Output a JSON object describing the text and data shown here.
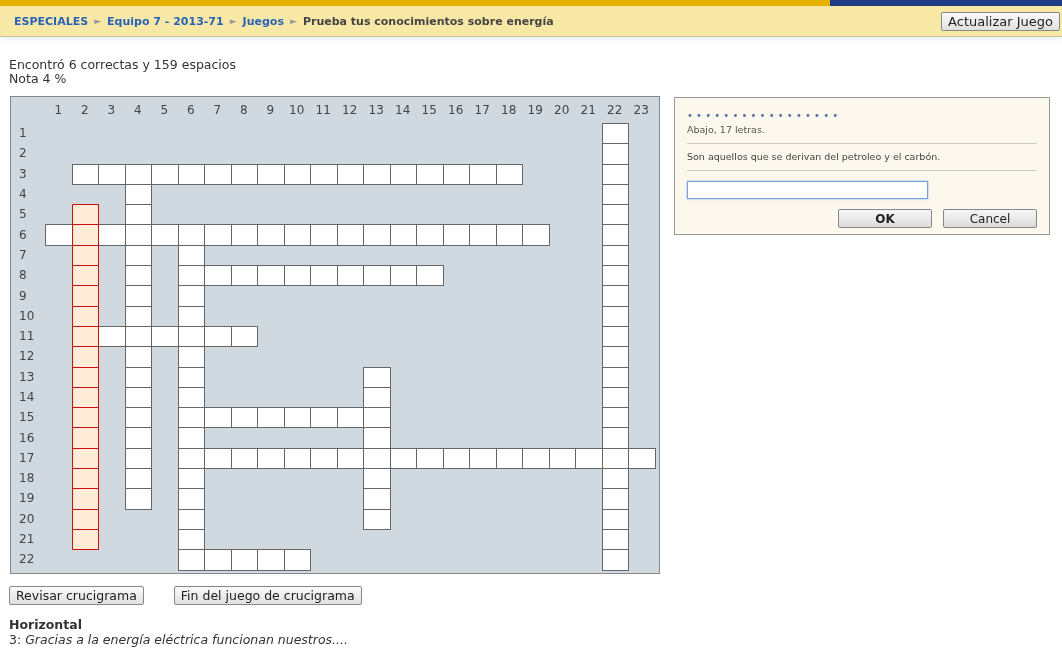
{
  "breadcrumb": [
    {
      "label": "ESPECIALES",
      "link": true
    },
    {
      "label": "Equipo 7 - 2013-71",
      "link": true
    },
    {
      "label": "Juegos",
      "link": true
    },
    {
      "label": "Prueba tus conocimientos sobre energía",
      "link": false
    }
  ],
  "breadcrumb_separator": "►",
  "update_button": "Actualizar Juego",
  "status": [
    "Encontró 6 correctas y 159 espacios",
    "Nota 4 %"
  ],
  "grid": {
    "column_numbers": [
      "1",
      "2",
      "3",
      "4",
      "5",
      "6",
      "7",
      "8",
      "9",
      "10",
      "11",
      "12",
      "13",
      "14",
      "15",
      "16",
      "17",
      "18",
      "19",
      "20",
      "21",
      "22",
      "23"
    ],
    "row_numbers": [
      "1",
      "2",
      "3",
      "4",
      "5",
      "6",
      "7",
      "8",
      "9",
      "10",
      "11",
      "12",
      "13",
      "14",
      "15",
      "16",
      "17",
      "18",
      "19",
      "20",
      "21",
      "22"
    ],
    "words": [
      {
        "selected": false
      },
      {
        "selected": false
      },
      {
        "selected": false
      },
      {
        "selected": false
      },
      {
        "selected": false
      },
      {
        "selected": false
      },
      {
        "selected": false
      },
      {
        "selected": false
      },
      {
        "selected": false
      },
      {
        "selected": true
      },
      {
        "selected": false
      },
      {
        "selected": false
      }
    ]
  },
  "dialog": {
    "dots": "• • • • • • • • • • • • • • • • •",
    "direction_info": "Abajo, 17 letras.",
    "clue": "Son aquellos que se derivan del petroleo y el carbón.",
    "buttons": [
      "OK",
      "Cancel"
    ]
  },
  "actions": [
    "Revisar crucigrama",
    "Fin del juego de crucigrama"
  ],
  "clues": {
    "heading": "Horizontal",
    "items": [
      {
        "number": "3:",
        "text": "Gracias a la energía eléctrica funcionan nuestros...."
      }
    ]
  }
}
